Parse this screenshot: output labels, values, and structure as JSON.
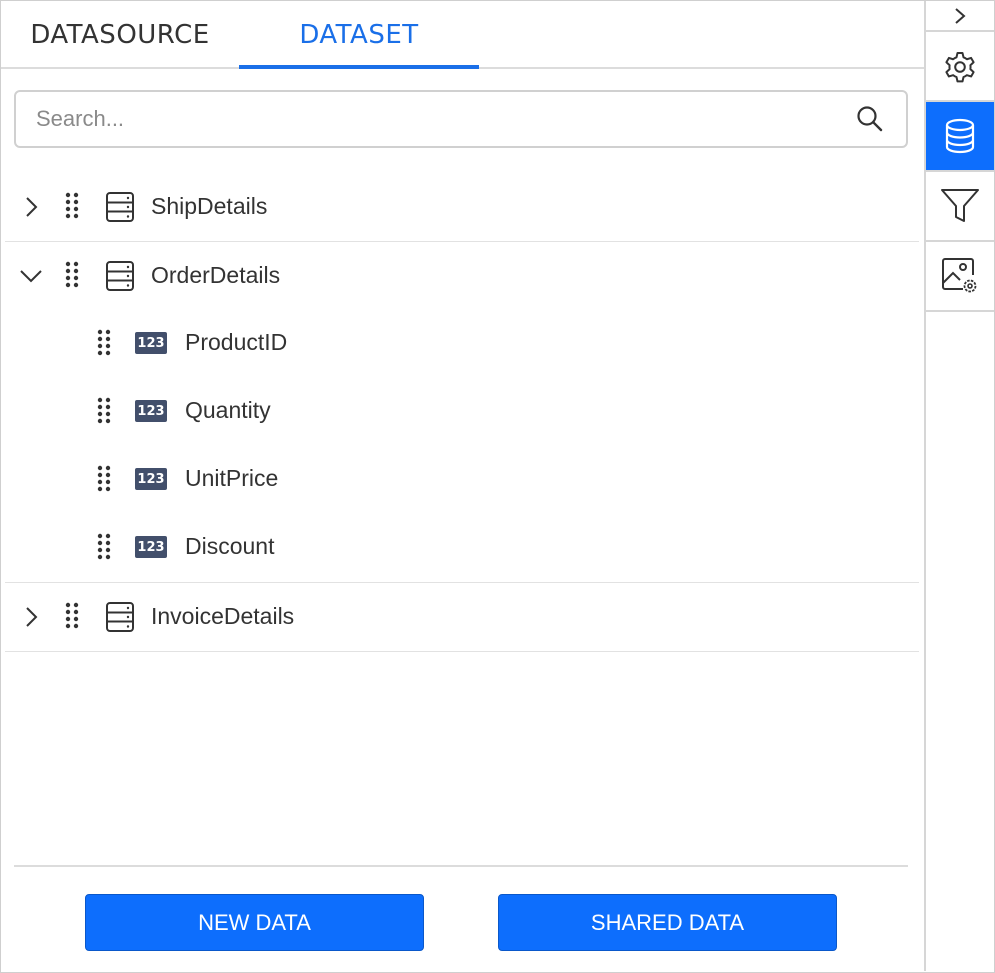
{
  "tabs": [
    {
      "label": "DATASOURCE",
      "active": false
    },
    {
      "label": "DATASET",
      "active": true
    }
  ],
  "search": {
    "placeholder": "Search...",
    "value": ""
  },
  "tree": {
    "ship_details": {
      "label": "ShipDetails",
      "expanded": false
    },
    "order_details": {
      "label": "OrderDetails",
      "expanded": true,
      "fields": [
        {
          "label": "ProductID",
          "type_badge": "123"
        },
        {
          "label": "Quantity",
          "type_badge": "123"
        },
        {
          "label": "UnitPrice",
          "type_badge": "123"
        },
        {
          "label": "Discount",
          "type_badge": "123"
        }
      ]
    },
    "invoice_details": {
      "label": "InvoiceDetails",
      "expanded": false
    }
  },
  "buttons": {
    "new_data": "NEW DATA",
    "shared_data": "SHARED DATA"
  },
  "rail": {
    "items": [
      {
        "icon": "chevron-right-icon"
      },
      {
        "icon": "gear-icon"
      },
      {
        "icon": "database-icon",
        "active": true
      },
      {
        "icon": "filter-icon"
      },
      {
        "icon": "image-settings-icon"
      }
    ]
  },
  "colors": {
    "accent": "#0d6efd",
    "tab_active": "#1a6fe8",
    "field_badge": "#424f6b",
    "text": "#333333"
  }
}
